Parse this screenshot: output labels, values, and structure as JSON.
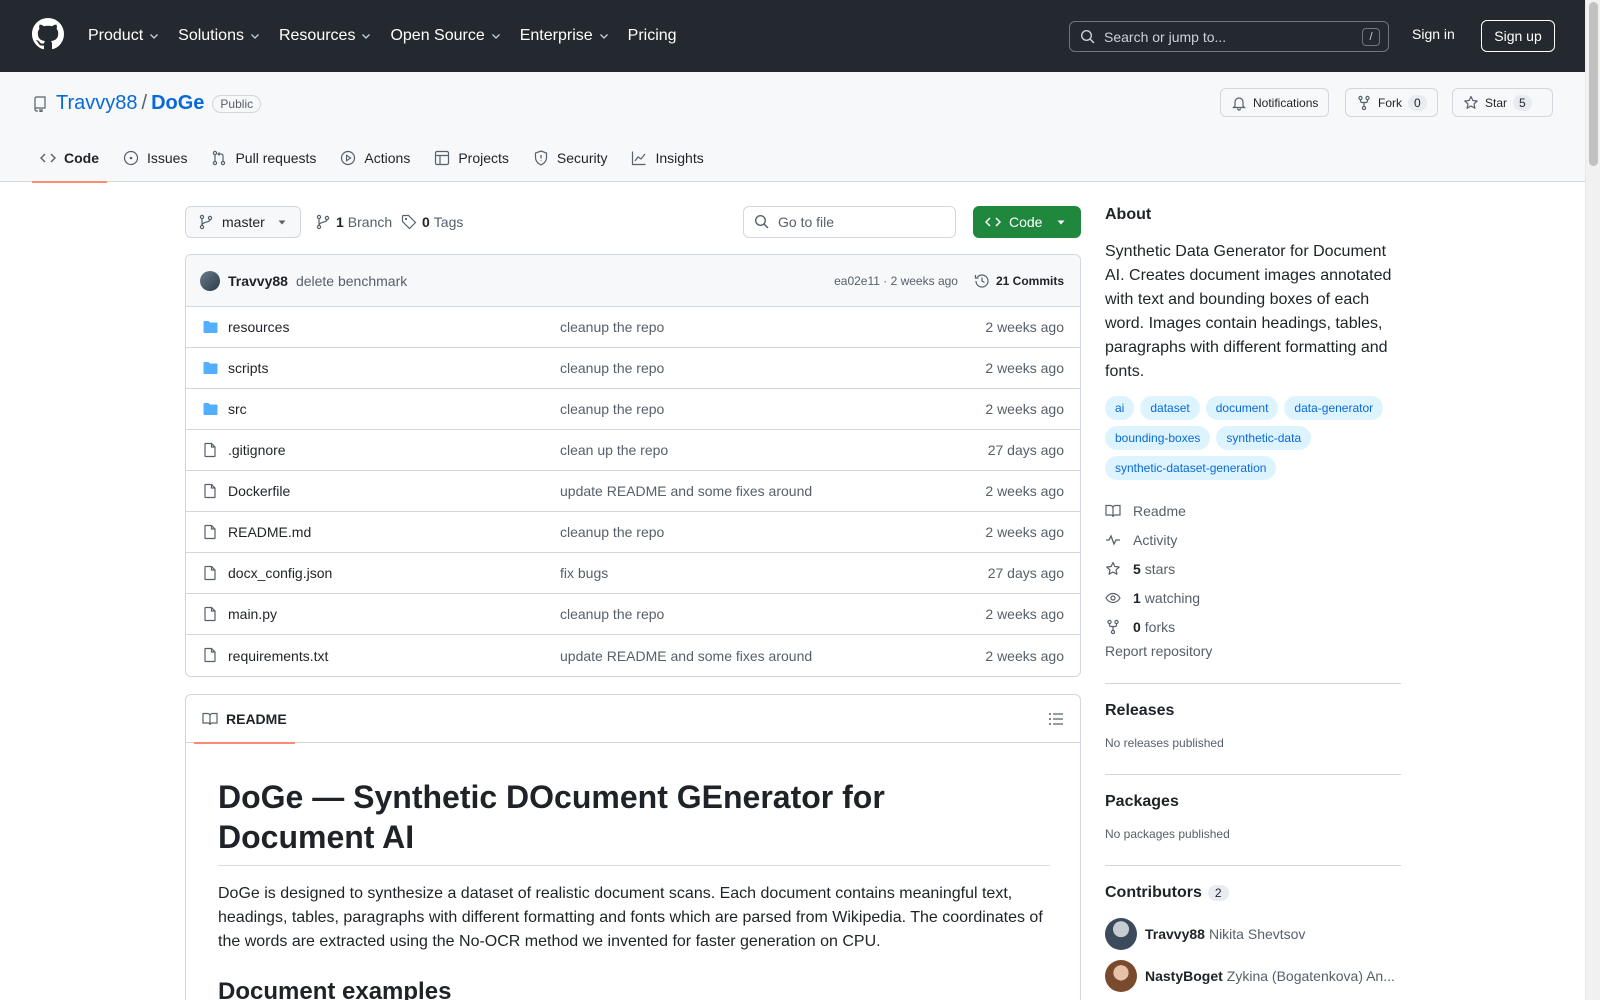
{
  "header": {
    "nav": [
      "Product",
      "Solutions",
      "Resources",
      "Open Source",
      "Enterprise",
      "Pricing"
    ],
    "search_placeholder": "Search or jump to...",
    "search_shortcut": "/",
    "signin": "Sign in",
    "signup": "Sign up"
  },
  "repo": {
    "owner": "Travvy88",
    "separator": "/",
    "name": "DoGe",
    "visibility": "Public",
    "notifications_label": "Notifications",
    "fork_label": "Fork",
    "fork_count": "0",
    "star_label": "Star",
    "star_count": "5",
    "tabs": [
      "Code",
      "Issues",
      "Pull requests",
      "Actions",
      "Projects",
      "Security",
      "Insights"
    ]
  },
  "toolbar": {
    "branch": "master",
    "branch_count": "1",
    "branch_label": "Branch",
    "tag_count": "0",
    "tag_label": "Tags",
    "goto_placeholder": "Go to file",
    "code_label": "Code"
  },
  "commit": {
    "author": "Travvy88",
    "message": "delete benchmark",
    "meta": "ea02e11 · 2 weeks ago",
    "commits_label": "21 Commits"
  },
  "files": [
    {
      "name": "resources",
      "type": "folder",
      "message": "cleanup the repo",
      "date": "2 weeks ago"
    },
    {
      "name": "scripts",
      "type": "folder",
      "message": "cleanup the repo",
      "date": "2 weeks ago"
    },
    {
      "name": "src",
      "type": "folder",
      "message": "cleanup the repo",
      "date": "2 weeks ago"
    },
    {
      "name": ".gitignore",
      "type": "file",
      "message": "clean up the repo",
      "date": "27 days ago"
    },
    {
      "name": "Dockerfile",
      "type": "file",
      "message": "update README and some fixes around",
      "date": "2 weeks ago"
    },
    {
      "name": "README.md",
      "type": "file",
      "message": "cleanup the repo",
      "date": "2 weeks ago"
    },
    {
      "name": "docx_config.json",
      "type": "file",
      "message": "fix bugs",
      "date": "27 days ago"
    },
    {
      "name": "main.py",
      "type": "file",
      "message": "cleanup the repo",
      "date": "2 weeks ago"
    },
    {
      "name": "requirements.txt",
      "type": "file",
      "message": "update README and some fixes around",
      "date": "2 weeks ago"
    }
  ],
  "readme": {
    "tab_label": "README",
    "title": "DoGe — Synthetic DOcument GEnerator for Document AI",
    "paragraph": "DoGe is designed to synthesize a dataset of realistic document scans. Each document contains meaningful text, headings, tables, paragraphs with different formatting and fonts which are parsed from Wikipedia. The coordinates of the words are extracted using the No-OCR method we invented for faster generation on CPU.",
    "h2": "Document examples"
  },
  "about": {
    "title": "About",
    "description": "Synthetic Data Generator for Document AI. Creates document images annotated with text and bounding boxes of each word. Images contain headings, tables, paragraphs with different formatting and fonts.",
    "topics": [
      "ai",
      "dataset",
      "document",
      "data-generator",
      "bounding-boxes",
      "synthetic-data",
      "synthetic-dataset-generation"
    ],
    "readme": "Readme",
    "activity": "Activity",
    "stars_count": "5",
    "stars_label": "stars",
    "watching_count": "1",
    "watching_label": "watching",
    "forks_count": "0",
    "forks_label": "forks",
    "report": "Report repository"
  },
  "releases": {
    "title": "Releases",
    "empty": "No releases published"
  },
  "packages": {
    "title": "Packages",
    "empty": "No packages published"
  },
  "contributors": {
    "title": "Contributors",
    "count": "2",
    "list": [
      {
        "login": "Travvy88",
        "name": "Nikita Shevtsov"
      },
      {
        "login": "NastyBoget",
        "name": "Zykina (Bogatenkova) An..."
      }
    ]
  },
  "colors": {
    "header_bg": "#24292f",
    "link": "#0969da",
    "code_button": "#1f883d",
    "tab_underline": "#fd8c73",
    "folder": "#54aeff"
  }
}
